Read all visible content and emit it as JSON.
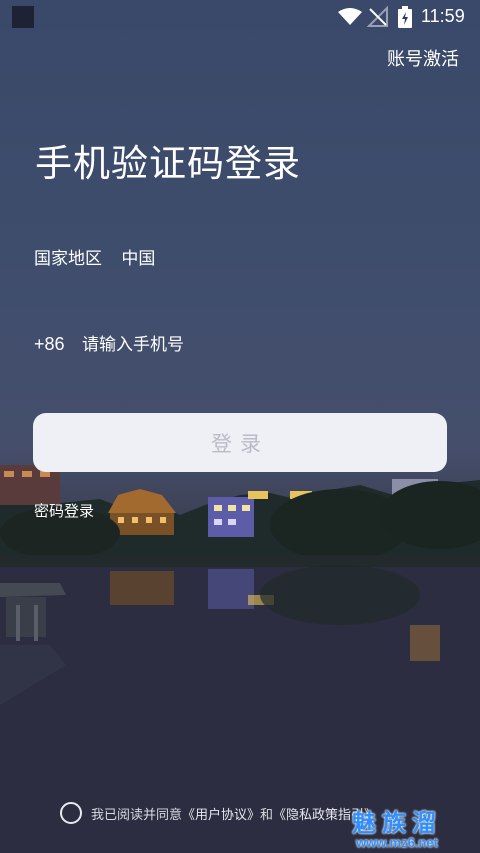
{
  "status_bar": {
    "time": "11:59",
    "icons": [
      "app-square-icon",
      "wifi-icon",
      "no-signal-icon",
      "battery-charging-icon"
    ]
  },
  "header": {
    "activate_label": "账号激活"
  },
  "main": {
    "title": "手机验证码登录",
    "region_label": "国家地区",
    "region_value": "中国",
    "country_code": "+86",
    "phone_placeholder": "请输入手机号",
    "login_button_label": "登录",
    "password_login_label": "密码登录"
  },
  "footer": {
    "agree_prefix": "我已阅读并同意",
    "user_agreement": "《用户协议》",
    "and": "和",
    "privacy_policy": "《隐私政策指引》"
  },
  "watermark": {
    "line1": "魅族溜",
    "line2": "www.mz6.net"
  },
  "colors": {
    "bg_top": "#3a4869",
    "bg_bottom": "#2a2b3d",
    "button_bg": "#eef0f5",
    "button_text": "#b9bcc6",
    "watermark": "#2f8fff"
  }
}
